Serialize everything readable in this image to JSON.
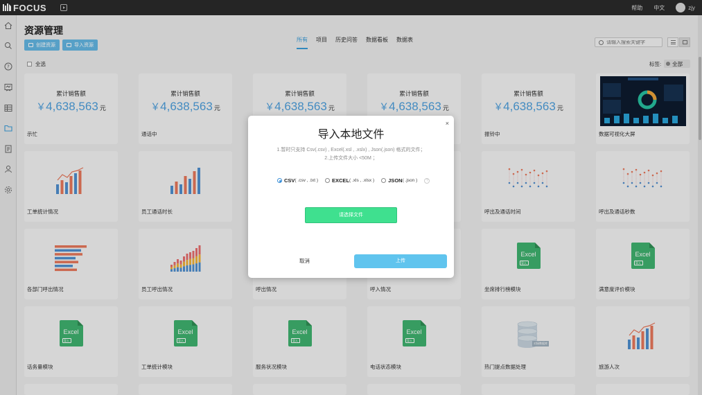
{
  "app": {
    "logo": "FOCUS"
  },
  "topbar": {
    "help": "帮助",
    "lang": "中文",
    "user": "zjy"
  },
  "sidebar": {
    "icons": [
      "home-icon",
      "search-icon",
      "help-icon",
      "board-icon",
      "table-icon",
      "folder-icon",
      "task-icon",
      "user-icon",
      "settings-icon"
    ]
  },
  "header": {
    "title": "资源管理",
    "create_label": "创建资源",
    "import_label": "导入资源",
    "tabs": [
      "所有",
      "项目",
      "历史问答",
      "数据看板",
      "数据表"
    ],
    "active_tab": "所有",
    "search_placeholder": "请输入搜索关键字"
  },
  "toolbar": {
    "select_all": "全选",
    "label_text": "标签:",
    "label_value": "全部"
  },
  "cards": [
    {
      "type": "kpi",
      "title": "示忙",
      "kpi_label": "累计销售额",
      "currency": "￥",
      "value": "4,638,563",
      "unit": "元"
    },
    {
      "type": "kpi",
      "title": "通话中",
      "kpi_label": "累计销售额",
      "currency": "￥",
      "value": "4,638,563",
      "unit": "元"
    },
    {
      "type": "kpi",
      "title": "",
      "kpi_label": "累计销售额",
      "currency": "￥",
      "value": "4,638,563",
      "unit": "元"
    },
    {
      "type": "kpi",
      "title": "",
      "kpi_label": "累计销售额",
      "currency": "￥",
      "value": "4,638,563",
      "unit": "元"
    },
    {
      "type": "kpi",
      "title": "振铃中",
      "kpi_label": "累计销售额",
      "currency": "￥",
      "value": "4,638,563",
      "unit": "元"
    },
    {
      "type": "dashboard",
      "title": "数据可视化大屏"
    },
    {
      "type": "barline",
      "title": "工单统计情况"
    },
    {
      "type": "barline2",
      "title": "员工通话时长"
    },
    {
      "type": "blank",
      "title": ""
    },
    {
      "type": "blank",
      "title": ""
    },
    {
      "type": "dots",
      "title": "呼出及通话时间"
    },
    {
      "type": "dots",
      "title": "呼出及通话秒数"
    },
    {
      "type": "hbar",
      "title": "各部门呼出情况"
    },
    {
      "type": "stack",
      "title": "员工呼出情况"
    },
    {
      "type": "blank",
      "title": "呼出情况"
    },
    {
      "type": "blank",
      "title": "呼入情况"
    },
    {
      "type": "excel",
      "title": "坐席排行榜模块",
      "badge": "导入"
    },
    {
      "type": "excel",
      "title": "满意度评价模块",
      "badge": "导入"
    },
    {
      "type": "excel",
      "title": "话务量模块",
      "badge": "导入"
    },
    {
      "type": "excel",
      "title": "工单统计模块",
      "badge": "导入"
    },
    {
      "type": "excel",
      "title": "服务状况模块",
      "badge": "导入"
    },
    {
      "type": "excel",
      "title": "电话状态模块",
      "badge": "导入"
    },
    {
      "type": "db",
      "title": "热门提点数据处理",
      "badge": "对接数据库"
    },
    {
      "type": "barline",
      "title": "旅游人次"
    }
  ],
  "excel_text": "Excel",
  "modal": {
    "close": "×",
    "title": "导入本地文件",
    "desc_line1": "1.暂时只支持 Csv(.csv) , Excel(.xsl , .xslx) , Json(.json) 格式的文件；",
    "desc_line2": "2.上传文件大小 <50M ；",
    "options": [
      {
        "label": "CSV",
        "ext": "( .csv , .txt )",
        "checked": true
      },
      {
        "label": "EXCEL",
        "ext": "( .xls , .xlsx )",
        "checked": false
      },
      {
        "label": "JSON",
        "ext": "( .json )",
        "checked": false
      }
    ],
    "help": "?",
    "choose_label": "请选择文件",
    "cancel_label": "取消",
    "upload_label": "上传"
  },
  "colors": {
    "accent": "#4d9fdc",
    "green": "#3fe08f",
    "upload": "#60c4ee",
    "excel": "#3fb26f",
    "bar_orange": "#e8775a",
    "bar_blue": "#4f8fcf"
  }
}
